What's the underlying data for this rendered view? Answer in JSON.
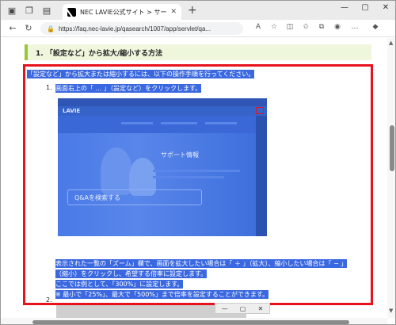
{
  "browser": {
    "tab_title": "NEC LAVIE公式サイト > サービス&サ",
    "tab_close": "✕",
    "new_tab": "+",
    "url": "https://faq.nec-lavie.jp/qasearch/1007/app/servlet/qa...",
    "window_controls": {
      "minimize": "—",
      "maximize": "▢",
      "close": "✕"
    }
  },
  "page": {
    "section_title": "1. 「設定など」から拡大/縮小する方法",
    "intro": "「設定など」から拡大または縮小するには、以下の操作手順を行ってください。",
    "steps": [
      {
        "num": "1.",
        "text": "画面右上の「 … 」（設定など）をクリックします。"
      },
      {
        "num": "2.",
        "lines": [
          "表示された一覧の「ズーム」欄で、画面を拡大したい場合は「 ＋ 」（拡大）、縮小したい場合は「 − 」",
          "（縮小）をクリックし、希望する倍率に設定します。",
          "ここでは例として、「300%」に設定します。",
          "※ 最小で「25%」、最大で「500%」まで倍率を設定することができます。"
        ]
      }
    ],
    "screenshot": {
      "logo": "LAVIE",
      "hero_title": "サポート情報",
      "search_placeholder": "Q&Aを検索する"
    },
    "popup_controls": [
      "—",
      "▢",
      "✕"
    ]
  },
  "colors": {
    "selection": "#3a68e0",
    "highlight_border": "#e8121f",
    "heading_bar": "#9cc43c"
  }
}
